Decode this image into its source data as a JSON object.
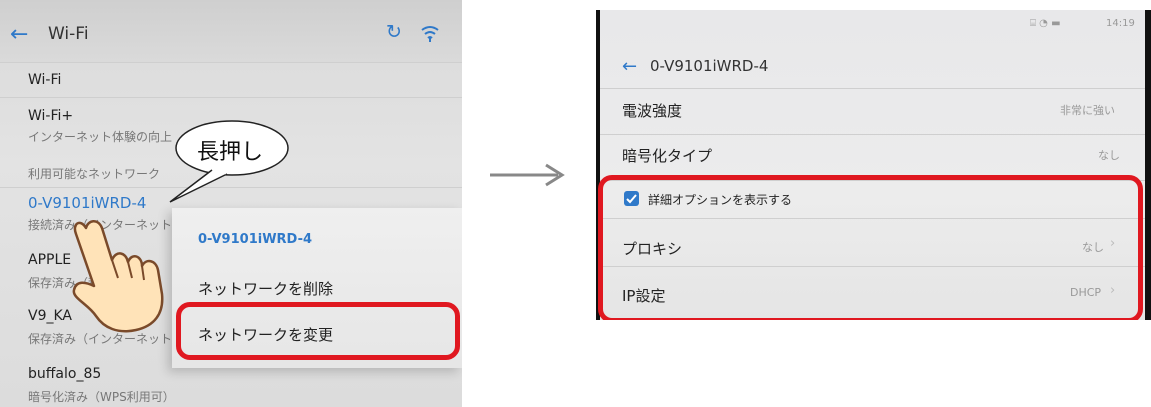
{
  "left": {
    "title": "Wi-Fi",
    "items": [
      {
        "title": "Wi-Fi"
      },
      {
        "title": "Wi-Fi+",
        "subtitle": "インターネット体験の向上"
      },
      {
        "section": "利用可能なネットワーク"
      },
      {
        "title": "0-V9101iWRD-4",
        "subtitle": "接続済み（インターネット"
      },
      {
        "title": "APPLE",
        "subtitle": "保存済み（利用"
      },
      {
        "title": "V9_KA",
        "subtitle": "保存済み（インターネット"
      },
      {
        "title": "buffalo_85",
        "subtitle": "暗号化済み（WPS利用可）"
      }
    ],
    "menu": {
      "network_name": "0-V9101iWRD-4",
      "delete": "ネットワークを削除",
      "modify": "ネットワークを変更"
    },
    "bubble": "長押し"
  },
  "right": {
    "status_time": "14:19",
    "title": "0-V9101iWRD-4",
    "rows": [
      {
        "label": "電波強度",
        "value": "非常に強い"
      },
      {
        "label": "暗号化タイプ",
        "value": "なし"
      }
    ],
    "advanced_option": "詳細オプションを表示する",
    "advanced_checked": true,
    "proxy": {
      "label": "プロキシ",
      "value": "なし"
    },
    "ip": {
      "label": "IP設定",
      "value": "DHCP"
    }
  },
  "colors": {
    "highlight": "#e01820",
    "accent": "#2f79c9"
  }
}
